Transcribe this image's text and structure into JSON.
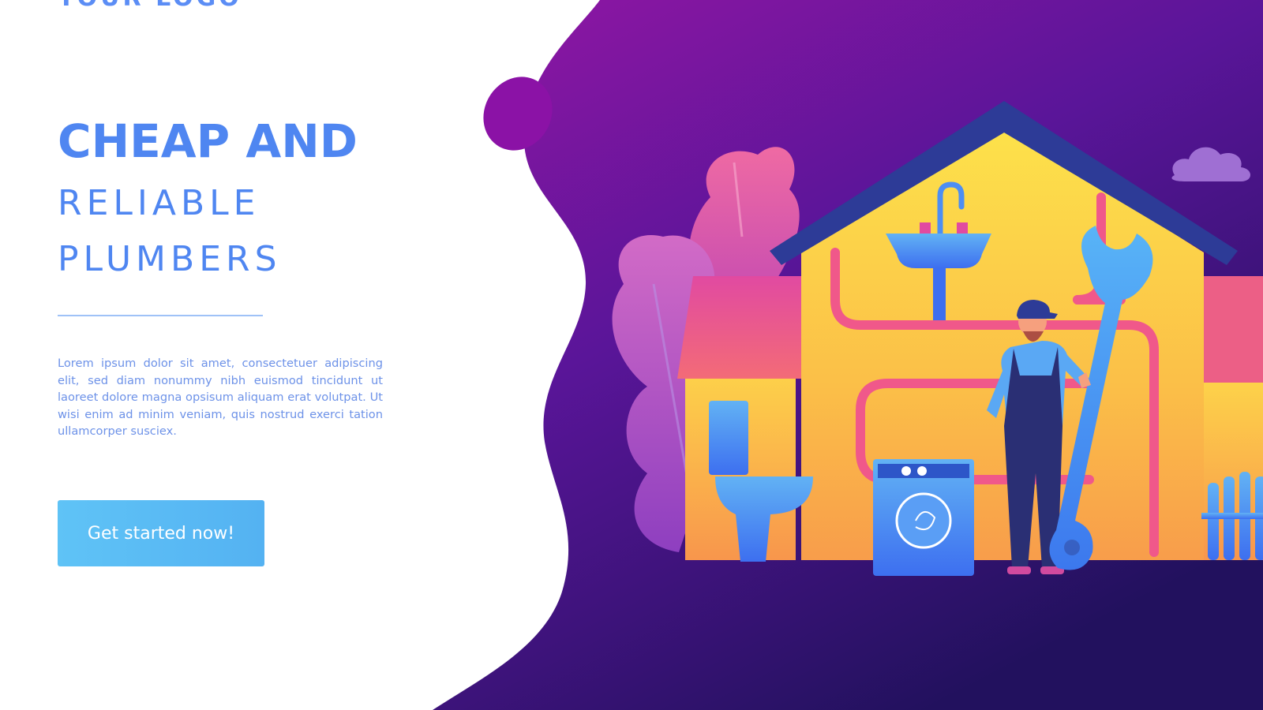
{
  "hero": {
    "logo_text": "YOUR LOGO",
    "headline_strong": "CHEAP AND",
    "headline_light_1": "RELIABLE",
    "headline_light_2": "PLUMBERS",
    "body": "Lorem ipsum dolor sit amet, consectetuer adipiscing elit, sed diam nonummy nibh euismod tincidunt ut laoreet dolore magna opsisum aliquam erat volutpat. Ut wisi enim ad minim veniam, quis nostrud exerci tation ullamcorper susciex.",
    "cta_label": "Get started now!"
  },
  "colors": {
    "accent": "#4f86f1",
    "button": "#5fc3f6",
    "blob_top": "#8e1aa8",
    "blob_bottom": "#241464"
  },
  "illustration": {
    "subject": "plumber-with-wrench",
    "items": [
      "house",
      "sink",
      "toilet",
      "washing-machine",
      "radiator",
      "plumber",
      "giant-wrench",
      "pipes",
      "cloud",
      "leaves"
    ]
  }
}
